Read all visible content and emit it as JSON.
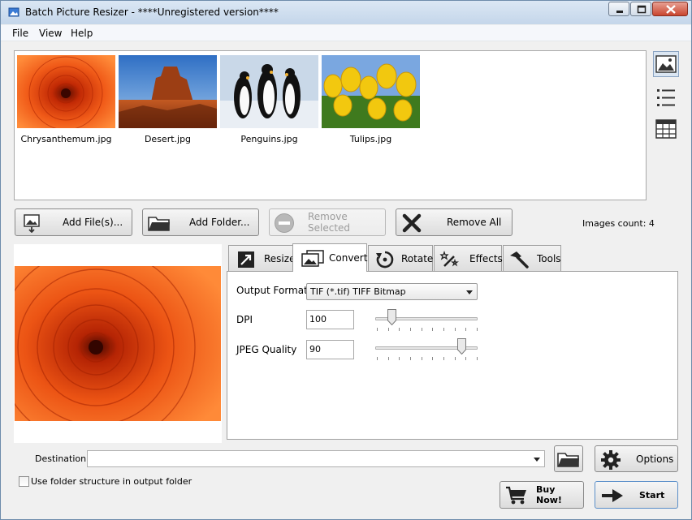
{
  "window": {
    "title": "Batch Picture Resizer - ****Unregistered version****"
  },
  "menu": [
    "File",
    "View",
    "Help"
  ],
  "thumbnails": [
    {
      "name": "Chrysanthemum.jpg"
    },
    {
      "name": "Desert.jpg"
    },
    {
      "name": "Penguins.jpg"
    },
    {
      "name": "Tulips.jpg"
    }
  ],
  "view_icons": [
    "thumbnail-view-icon",
    "list-view-icon",
    "table-view-icon"
  ],
  "actions": {
    "add_files": "Add File(s)...",
    "add_folder": "Add Folder...",
    "remove_selected": "Remove Selected",
    "remove_all": "Remove All"
  },
  "images_count": "Images count: 4",
  "tabs": [
    {
      "label": "Resize",
      "active": false
    },
    {
      "label": "Convert",
      "active": true
    },
    {
      "label": "Rotate",
      "active": false
    },
    {
      "label": "Effects",
      "active": false
    },
    {
      "label": "Tools",
      "active": false
    }
  ],
  "convert": {
    "output_format_label": "Output Format",
    "output_format_value": "TIF (*.tif) TIFF Bitmap",
    "dpi_label": "DPI",
    "dpi_value": "100",
    "dpi_slider_fraction": 0.13,
    "jpeg_quality_label": "JPEG Quality",
    "jpeg_quality_value": "90",
    "jpeg_slider_fraction": 0.88
  },
  "destination": {
    "label": "Destination",
    "value": ""
  },
  "options_button": "Options",
  "use_folder_structure": {
    "label": "Use folder structure in output folder",
    "checked": false
  },
  "buy_button": "Buy Now!",
  "start_button": "Start"
}
